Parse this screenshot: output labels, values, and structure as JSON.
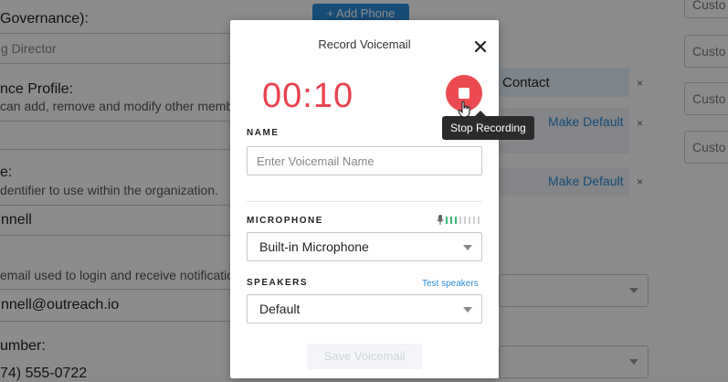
{
  "background": {
    "governance_label": "Governance):",
    "director_placeholder": "g Director",
    "compliance_label": "nce Profile:",
    "compliance_desc": "can add, remove and modify other memb",
    "identifier_label": "e:",
    "identifier_desc": "dentifier to use within the organization.",
    "name_value": "nnell",
    "email_desc": "email used to login and receive notificatio",
    "email_value": "nnell@outreach.io",
    "number_label": "umber:",
    "phone_value": "74) 555-0722",
    "add_phone_label": "+ Add Phone",
    "contact_label": "Contact",
    "make_default_1": "Make Default",
    "make_default_2": "Make Default",
    "custom_1": "Custo",
    "custom_2": "Custo",
    "custom_3": "Custo",
    "custom_4": "Custo",
    "remove_glyph": "×"
  },
  "modal": {
    "title": "Record Voicemail",
    "timer": "00:10",
    "tooltip": "Stop Recording",
    "name_label": "NAME",
    "name_placeholder": "Enter Voicemail Name",
    "microphone_label": "MICROPHONE",
    "microphone_value": "Built-in Microphone",
    "speakers_label": "SPEAKERS",
    "test_speakers": "Test speakers",
    "speakers_value": "Default",
    "save_label": "Save Voicemail"
  },
  "colors": {
    "accent": "#2a8bd9",
    "record_red": "#ea4a50",
    "timer_red": "#e8424f",
    "meter_green": "#3cb878"
  },
  "icons": {
    "close": "close-icon",
    "stop": "stop-icon",
    "microphone": "microphone-icon",
    "cursor": "hand-cursor-icon"
  }
}
